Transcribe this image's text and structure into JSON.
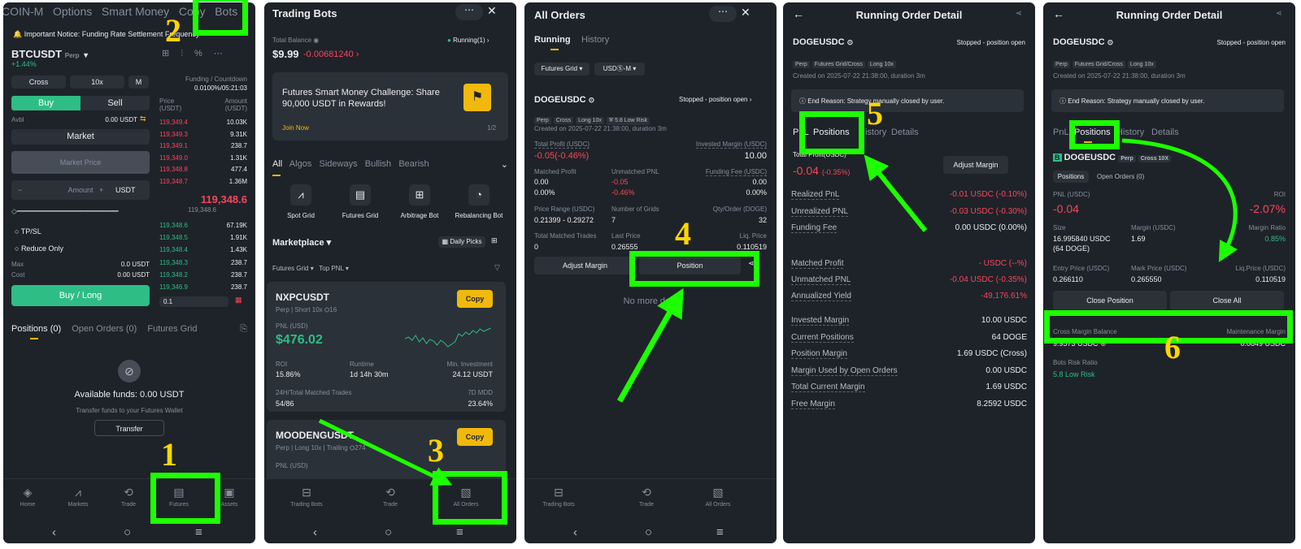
{
  "panel1": {
    "tabs": [
      "COIN-M",
      "Options",
      "Smart Money",
      "Copy",
      "Bots"
    ],
    "notice": "Important Notice: Funding Rate Settlement Frequency",
    "symbol": "BTCUSDT",
    "perp": "Perp",
    "change": "+1.44%",
    "margin_mode": "Cross",
    "leverage": "10x",
    "mode_m": "M",
    "funding_label": "Funding / Countdown",
    "funding_value": "0.0100%/05:21:03",
    "buy": "Buy",
    "sell": "Sell",
    "price_hdr": "Price\n(USDT)",
    "amount_hdr": "Amount\n(USDT)",
    "avbl_label": "Avbl",
    "avbl_value": "0.00 USDT",
    "order_type": "Market",
    "market_price": "Market Price",
    "amount_ph": "Amount",
    "amount_unit": "USDT",
    "tpsl": "TP/SL",
    "reduce_only": "Reduce Only",
    "max_label": "Max",
    "max_value": "0.0 USDT",
    "cost_label": "Cost",
    "cost_value": "0.00 USDT",
    "buy_long": "Buy / Long",
    "asks": [
      [
        "119,349.4",
        "10.03K"
      ],
      [
        "119,349.3",
        "9.31K"
      ],
      [
        "119,349.1",
        "238.7"
      ],
      [
        "119,349.0",
        "1.31K"
      ],
      [
        "119,348.8",
        "477.4"
      ],
      [
        "119,348.7",
        "1.36M"
      ]
    ],
    "mid_price": "119,348.6",
    "mid_sub": "119,348.6",
    "bids": [
      [
        "119,348.6",
        "67.19K"
      ],
      [
        "119,348.5",
        "1.91K"
      ],
      [
        "119,348.4",
        "1.43K"
      ],
      [
        "119,348.3",
        "238.7"
      ],
      [
        "119,348.2",
        "238.7"
      ],
      [
        "119,346.9",
        "238.7"
      ]
    ],
    "depth": "0.1",
    "bottom_tabs": [
      "Positions (0)",
      "Open Orders (0)",
      "Futures Grid"
    ],
    "available": "Available funds: 0.00 USDT",
    "transfer_hint": "Transfer funds to your Futures Wallet",
    "transfer_btn": "Transfer",
    "nav": [
      "Home",
      "Markets",
      "Trade",
      "Futures",
      "Assets"
    ]
  },
  "panel2": {
    "title": "Trading Bots",
    "total_balance_label": "Total Balance",
    "balance": "$9.99",
    "balance_change": "-0.00681240",
    "running": "Running(1)",
    "banner_text": "Futures Smart Money Challenge: Share 90,000 USDT in Rewards!",
    "join": "Join Now",
    "page": "1/2",
    "filters": [
      "All",
      "Algos",
      "Sideways",
      "Bullish",
      "Bearish"
    ],
    "bots": [
      "Spot Grid",
      "Futures Grid",
      "Arbitrage Bot",
      "Rebalancing Bot"
    ],
    "marketplace": "Marketplace",
    "daily_picks": "Daily Picks",
    "sub_filters": [
      "Futures Grid",
      "Top PNL"
    ],
    "card1": {
      "symbol": "NXPCUSDT",
      "tags": "Perp | Short 10x",
      "users": "16",
      "copy": "Copy",
      "pnl_label": "PNL (USD)",
      "pnl": "$476.02",
      "roi_label": "ROI",
      "roi": "15.86%",
      "runtime_label": "Runtime",
      "runtime": "1d 14h 30m",
      "mininv_label": "Min. Investment",
      "mininv": "24.12 USDT",
      "matched_label": "24H/Total Matched Trades",
      "matched": "54/86",
      "mdd_label": "7D MDD",
      "mdd": "23.64%"
    },
    "card2": {
      "symbol": "MOODENGUSDT",
      "tags": "Perp | Long 10x | Trailing",
      "users": "274",
      "copy": "Copy",
      "pnl_label": "PNL (USD)"
    },
    "nav": [
      "Trading Bots",
      "Trade",
      "All Orders"
    ]
  },
  "panel3": {
    "title": "All Orders",
    "tabs": [
      "Running",
      "History"
    ],
    "filters": [
      "Futures Grid",
      "USDⓈ-M"
    ],
    "symbol": "DOGEUSDC",
    "status": "Stopped - position open",
    "tags": [
      "Perp",
      "Cross",
      "Long 10x",
      "5.8 Low Risk"
    ],
    "created": "Created on 2025-07-22 21:38:00, duration 3m",
    "profit_label": "Total Profit (USDC)",
    "profit": "-0.05(-0.46%)",
    "invested_label": "Invested Margin (USDC)",
    "invested": "10.00",
    "matched_profit_label": "Matched Profit",
    "matched_profit": "0.00",
    "matched_profit_pct": "0.00%",
    "unmatched_label": "Unmatched PNL",
    "unmatched": "-0.05",
    "unmatched_pct": "-0.46%",
    "funding_label": "Funding Fee (USDC)",
    "funding": "0.00",
    "funding_pct": "0.00%",
    "range_label": "Price Range (USDC)",
    "range": "0.21399 - 0.29272",
    "grids_label": "Number of Grids",
    "grids": "7",
    "qty_label": "Qty/Order (DOGE)",
    "qty": "32",
    "trades_label": "Total Matched Trades",
    "trades": "0",
    "last_label": "Last Price",
    "last": "0.26555",
    "liq_label": "Liq. Price",
    "liq": "0.110519",
    "adjust": "Adjust Margin",
    "position": "Position",
    "no_more": "No more data",
    "nav": [
      "Trading Bots",
      "Trade",
      "All Orders"
    ]
  },
  "panel4": {
    "title": "Running Order Detail",
    "symbol": "DOGEUSDC",
    "status": "Stopped - position open",
    "tags": [
      "Perp",
      "Futures Grid/Cross",
      "Long 10x"
    ],
    "created": "Created on 2025-07-22 21:38:00, duration 3m",
    "end_reason": "End Reason: Strategy manually closed by user.",
    "tabs": [
      "PnL",
      "Positions",
      "History",
      "Details"
    ],
    "profit_label": "Total Profit(USDC)",
    "profit": "-0.04",
    "profit_pct": "(-0.35%)",
    "adjust": "Adjust Margin",
    "rows1": [
      [
        "Realized PnL",
        "-0.01 USDC (-0.10%)"
      ],
      [
        "Unrealized PNL",
        "-0.03 USDC (-0.30%)"
      ],
      [
        "Funding Fee",
        "0.00 USDC (0.00%)"
      ]
    ],
    "rows2": [
      [
        "Matched Profit",
        "- USDC (--%)"
      ],
      [
        "Unmatched PNL",
        "-0.04 USDC (-0.35%)"
      ],
      [
        "Annualized Yield",
        "-49,176.61%"
      ]
    ],
    "rows3": [
      [
        "Invested Margin",
        "10.00 USDC"
      ],
      [
        "Current Positions",
        "64 DOGE"
      ],
      [
        "Position Margin",
        "1.69 USDC (Cross)"
      ],
      [
        "Margin Used by Open Orders",
        "0.00 USDC"
      ],
      [
        "Total Current Margin",
        "1.69 USDC"
      ],
      [
        "Free Margin",
        "8.2592 USDC"
      ]
    ]
  },
  "panel5": {
    "title": "Running Order Detail",
    "symbol": "DOGEUSDC",
    "status": "Stopped - position open",
    "tags": [
      "Perp",
      "Futures Grid/Cross",
      "Long 10x"
    ],
    "created": "Created on 2025-07-22 21:38:00, duration 3m",
    "end_reason": "End Reason: Strategy manually closed by user.",
    "tabs": [
      "PnL",
      "Positions",
      "History",
      "Details"
    ],
    "pos_symbol": "DOGEUSDC",
    "pos_tags": [
      "Perp",
      "Cross 10X"
    ],
    "sub_tabs": [
      "Positions",
      "Open Orders (0)"
    ],
    "pnl_label": "PNL (USDC)",
    "pnl": "-0.04",
    "roi_label": "ROI",
    "roi": "-2.07%",
    "size_label": "Size",
    "size": "16.995840 USDC",
    "size2": "(64 DOGE)",
    "margin_label": "Margin (USDC)",
    "margin": "1.69",
    "ratio_label": "Margin Ratio",
    "ratio": "0.85%",
    "entry_label": "Entry Price (USDC)",
    "entry": "0.266110",
    "mark_label": "Mark Price (USDC)",
    "mark": "0.265550",
    "liq_label": "Liq.Price (USDC)",
    "liq": "0.110519",
    "close_position": "Close Position",
    "close_all": "Close All",
    "cross_label": "Cross Margin Balance",
    "cross": "9.9573 USDC",
    "maint_label": "Maintenance Margin",
    "maint": "0.0849 USDC",
    "risk_label": "Bots Risk Ratio",
    "risk": "5.8 Low Risk"
  },
  "steps": [
    "1",
    "2",
    "3",
    "4",
    "5",
    "6"
  ],
  "colors": {
    "highlight": "#1dff00",
    "step": "#ffd500",
    "up": "#2ebd85",
    "down": "#f6465d",
    "brand": "#f0b90b",
    "bg": "#1e2329"
  }
}
